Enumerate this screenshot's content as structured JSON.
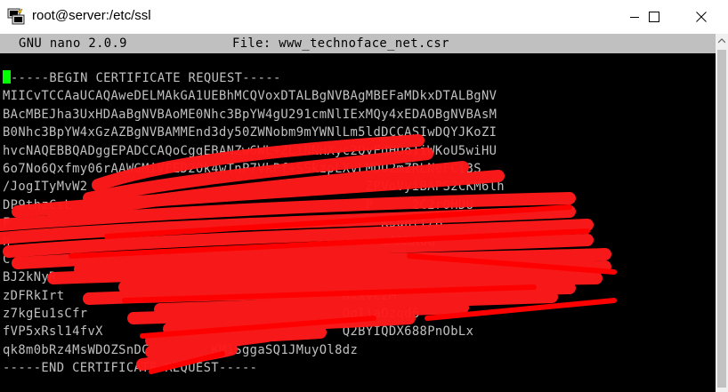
{
  "window": {
    "title": "root@server:/etc/ssl",
    "icon": "putty-icon"
  },
  "nano": {
    "version_label": "GNU nano 2.0.9",
    "file_label": "File: www_technoface_net.csr"
  },
  "file_lines": [
    "-----BEGIN CERTIFICATE REQUEST-----",
    "MIICvTCCAaUCAQAweDELMAkGA1UEBhMCQVoxDTALBgNVBAgMBEFaMDkxDTALBgNV",
    "BAcMBEJha3UxHDAaBgNVBAoME0Nhc3BpYW4gU291cmNlIExMQy4xEDAOBgNVBAsM",
    "B0Nhc3BpYW4xGzAZBgNVBAMMEnd3dy50ZWNobm9mYWNlLm5ldDCCASIwDQYJKoZI",
    "hvcNAQEBBQADggEPADCCAQoCggEBANZw6WL+ZLiNNHXyc2QyEdHOo1iWKoU5wiHU",
    "6o7No6Qxfmy06rAAWGMiVFED2Ok4wTnP7VkPf+SSkzpLXvLMDU2mZRLNeFCi3S",
    "/JogITyMvW2                                    ZPVoVyiBAPS2CKM6lh",
    "DP9thzCsL                                      P     2C2r0HDU",
    "F                                                Ksghlf/B",
    "h                                                aAAMA0G",
    "C                                                    ",
    "BJ2kNyR                                                ",
    "zDFRkIrt                                    Nxxvc2M",
    "z7kgEu1sCfr                                 OqljaOzqd6",
    "fVP5xRsl14fvX                               Q2BYIQDX688PnObLx",
    "qk8m0bRz4MsWDOZSnDC        KM1SggaSQ1JMuyOl8dz",
    "-----END CERTIFICATE REQUEST-----"
  ],
  "colors": {
    "terminal_bg": "#000000",
    "terminal_fg": "#c0c0c0",
    "header_bg": "#c0c0c0",
    "cursor": "#00ff00",
    "redaction": "#ff0000"
  }
}
